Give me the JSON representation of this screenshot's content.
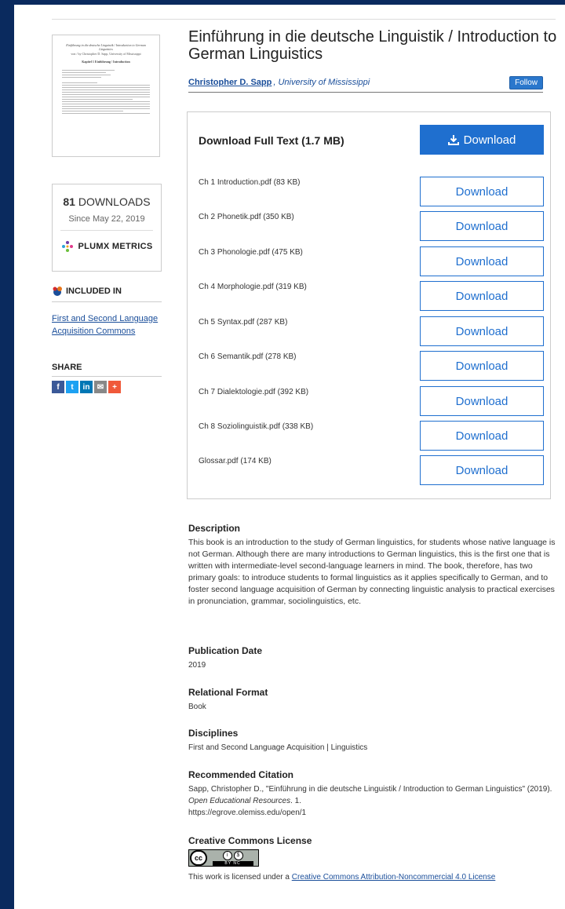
{
  "thumbnail": {
    "title_line": "Einführung in die deutsche Linguistik / Introduction to German Linguistics",
    "author_line": "von / by Christopher D. Sapp, University of Mississippi",
    "chapter_line": "Kapitel 1 Einführung / Introduction"
  },
  "stats": {
    "downloads_count": "81",
    "downloads_label": "DOWNLOADS",
    "since": "Since May 22, 2019",
    "plumx_label": "PLUMX METRICS"
  },
  "included_in": {
    "heading": "INCLUDED IN",
    "link": "First and Second Language Acquisition Commons"
  },
  "share": {
    "heading": "SHARE",
    "buttons": [
      "f",
      "t",
      "in",
      "✉",
      "+"
    ]
  },
  "title": "Einführung in die deutsche Linguistik / Introduction to German Linguistics",
  "author": {
    "name": "Christopher D. Sapp",
    "affiliation": ", University of Mississippi",
    "follow_label": "Follow"
  },
  "downloads": {
    "full_label": "Download Full Text   (1.7 MB)",
    "full_button": "Download",
    "files": [
      {
        "name": "Ch 1 Introduction.pdf  (83 KB)",
        "button": "Download"
      },
      {
        "name": "Ch 2 Phonetik.pdf  (350 KB)",
        "button": "Download"
      },
      {
        "name": "Ch 3 Phonologie.pdf  (475 KB)",
        "button": "Download"
      },
      {
        "name": "Ch 4 Morphologie.pdf  (319 KB)",
        "button": "Download"
      },
      {
        "name": "Ch 5 Syntax.pdf  (287 KB)",
        "button": "Download"
      },
      {
        "name": "Ch 6 Semantik.pdf  (278 KB)",
        "button": "Download"
      },
      {
        "name": "Ch 7 Dialektologie.pdf  (392 KB)",
        "button": "Download"
      },
      {
        "name": "Ch 8 Soziolinguistik.pdf  (338 KB)",
        "button": "Download"
      },
      {
        "name": "Glossar.pdf  (174 KB)",
        "button": "Download"
      }
    ]
  },
  "description": {
    "heading": "Description",
    "text": "This book is an introduction to the study of German linguistics, for students whose native language is not German. Although there are many introductions to German linguistics, this is the first one that is written with intermediate-level second-language learners in mind. The book, therefore, has two primary goals: to introduce students to formal linguistics as it applies specifically to German, and to foster second language acquisition of German by connecting linguistic analysis to practical exercises in pronunciation, grammar, sociolinguistics, etc."
  },
  "publication_date": {
    "heading": "Publication Date",
    "value": "2019"
  },
  "relational_format": {
    "heading": "Relational Format",
    "value": "Book"
  },
  "disciplines": {
    "heading": "Disciplines",
    "value": "First and Second Language Acquisition | Linguistics"
  },
  "citation": {
    "heading": "Recommended Citation",
    "text_before": "Sapp, Christopher D., \"Einführung in die deutsche Linguistik / Introduction to German Linguistics\" (2019). ",
    "series": "Open Educational Resources",
    "text_after": ". 1.",
    "url": "https://egrove.olemiss.edu/open/1"
  },
  "license": {
    "heading": "Creative Commons License",
    "badge_cc": "cc",
    "badge_by_nc": "BY  NC",
    "text": "This work is licensed under a ",
    "link": "Creative Commons Attribution-Noncommercial 4.0 License"
  },
  "colors": {
    "accent": "#1f6fcf",
    "link": "#1a4e9a",
    "frame": "#0a2a5e"
  }
}
